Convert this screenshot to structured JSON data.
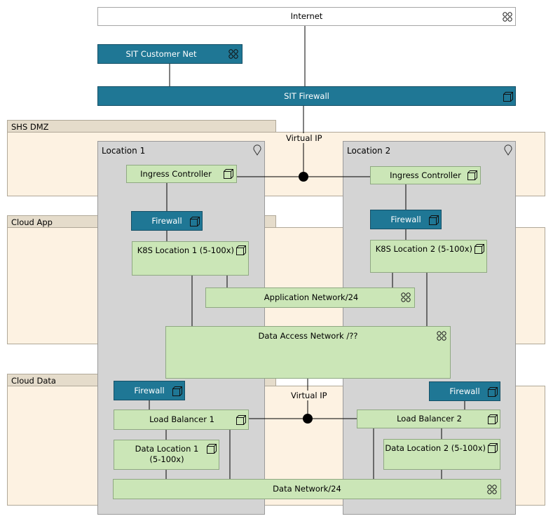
{
  "zones": {
    "dmz": "SHS DMZ",
    "cloud_app": "Cloud App",
    "cloud_data": "Cloud Data"
  },
  "locations": {
    "loc1": "Location 1",
    "loc2": "Location 2"
  },
  "nodes": {
    "internet": "Internet",
    "sit_customer_net": "SIT Customer Net",
    "sit_firewall": "SIT Firewall",
    "ingress1": "Ingress Controller",
    "ingress2": "Ingress Controller",
    "firewall_app1": "Firewall",
    "firewall_app2": "Firewall",
    "k8s1": "K8S Location 1 (5-100x)",
    "k8s2": "K8S Location 2 (5-100x)",
    "app_network": "Application Network/24",
    "data_access_network": "Data Access Network /??",
    "firewall_data1": "Firewall",
    "firewall_data2": "Firewall",
    "lb1": "Load Balancer 1",
    "lb2": "Load Balancer 2",
    "data_loc1_line1": "Data Location 1",
    "data_loc1_line2": "(5-100x)",
    "data_loc2": "Data Location 2 (5-100x)",
    "data_network": "Data Network/24"
  },
  "junctions": {
    "vip_top": "Virtual IP",
    "vip_bottom": "Virtual IP"
  },
  "icons": {
    "network": "network-icon",
    "node": "node-cube-icon",
    "location": "location-pin-icon"
  },
  "colors": {
    "zone_tab": "#e5dccb",
    "zone_body": "#fdf2e2",
    "location": "#d4d4d4",
    "node_green": "#cbe6b7",
    "node_blue": "#1f7795"
  }
}
